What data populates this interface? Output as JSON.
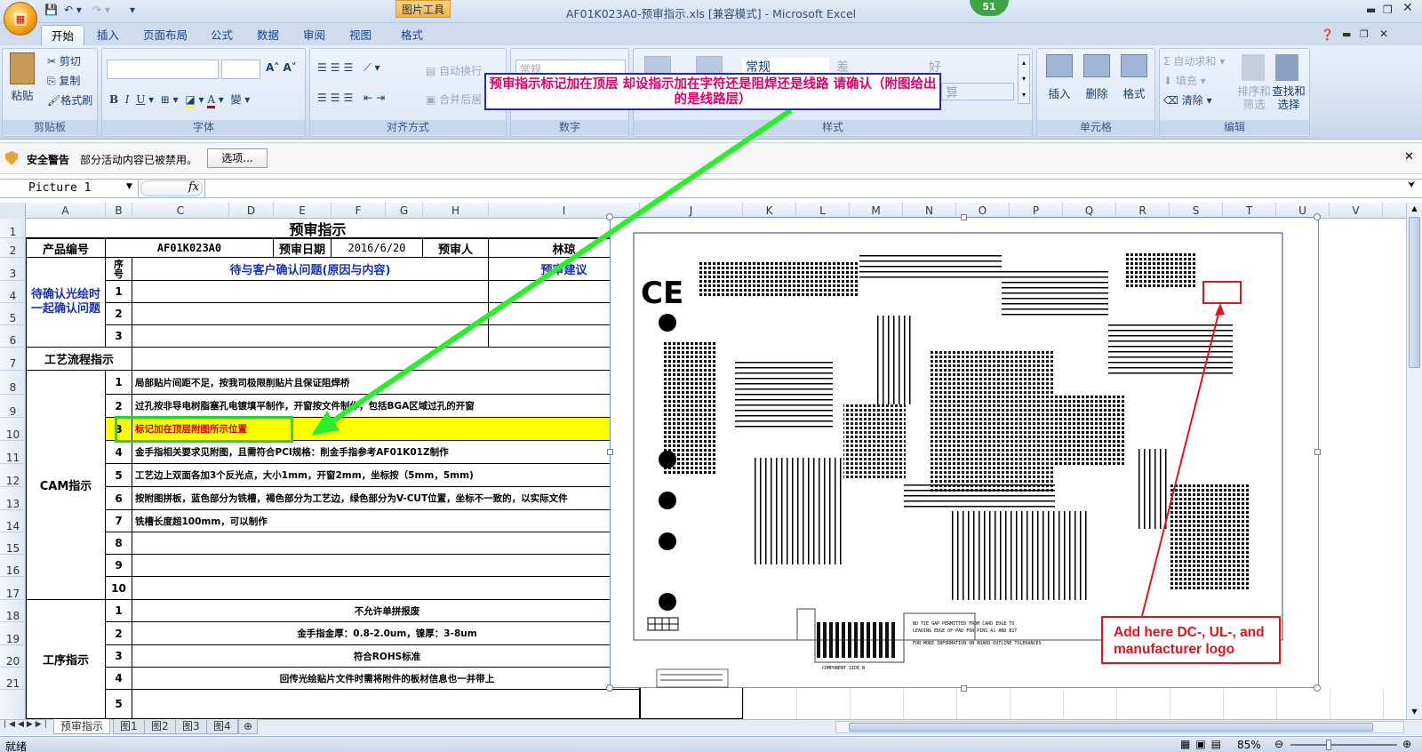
{
  "window": {
    "title": "AF01K023A0-预审指示.xls  [兼容模式] - Microsoft Excel",
    "tools_tab": "图片工具",
    "badge": "51"
  },
  "tabs": [
    "开始",
    "插入",
    "页面布局",
    "公式",
    "数据",
    "审阅",
    "视图",
    "格式"
  ],
  "ribbon": {
    "clipboard": {
      "paste": "粘贴",
      "cut": "剪切",
      "copy": "复制",
      "format_painter": "格式刷",
      "label": "剪贴板"
    },
    "font": {
      "label": "字体"
    },
    "align": {
      "wrap": "自动换行",
      "merge": "合并后居",
      "label": "对齐方式"
    },
    "number": {
      "format": "常规",
      "label": "数字"
    },
    "styles": {
      "normal": "常规",
      "bad": "差",
      "good": "好",
      "calc": "算",
      "label": "样式"
    },
    "cells": {
      "insert": "插入",
      "delete": "删除",
      "format": "格式",
      "label": "单元格"
    },
    "editing": {
      "autosum": "自动求和",
      "fill": "填充",
      "clear": "清除",
      "sort": "排序和",
      "sort2": "筛选",
      "find": "查找和",
      "find2": "选择",
      "label": "编辑"
    }
  },
  "security": {
    "label": "安全警告",
    "message": "部分活动内容已被禁用。",
    "options": "选项..."
  },
  "namebox": "Picture 1",
  "fx": "fx",
  "columns": [
    "A",
    "B",
    "C",
    "D",
    "E",
    "F",
    "G",
    "H",
    "I",
    "J",
    "K",
    "L",
    "M",
    "N",
    "O",
    "P",
    "Q",
    "R",
    "S",
    "T",
    "U",
    "V"
  ],
  "rows": [
    "1",
    "2",
    "3",
    "4",
    "5",
    "6",
    "7",
    "8",
    "9",
    "10",
    "11",
    "12",
    "13",
    "14",
    "15",
    "16",
    "17",
    "18",
    "19",
    "20",
    "21"
  ],
  "sheet": {
    "title": "预审指示",
    "product_no_label": "产品编号",
    "product_no": "AF01K023A0",
    "date_label": "预审日期",
    "date": "2016/6/20",
    "reviewer_label": "预审人",
    "reviewer": "林琼",
    "seq_header": "序号",
    "issue_header": "待与客户确认问题(原因与内容)",
    "advice_header": "预审建议",
    "pending_label": "待确认光绘时一起确认问题",
    "pending_nums": [
      "1",
      "2",
      "3"
    ],
    "process_label": "工艺流程指示",
    "cam_label": "CAM指示",
    "cam_items": [
      {
        "n": "1",
        "t": "局部贴片间距不足，按我司极限削贴片且保证阻焊桥"
      },
      {
        "n": "2",
        "t": "过孔按非导电树脂塞孔电镀填平制作，开窗按文件制作，包括BGA区域过孔的开窗"
      },
      {
        "n": "3",
        "t": "标记加在顶层附图所示位置"
      },
      {
        "n": "4",
        "t": "金手指相关要求见附图，且需符合PCI规格：削金手指参考AF01K01Z制作"
      },
      {
        "n": "5",
        "t": "工艺边上双面各加3个反光点，大小1mm，开窗2mm，坐标按（5mm，5mm)"
      },
      {
        "n": "6",
        "t": "按附图拼板，蓝色部分为铣槽，褐色部分为工艺边，绿色部分为V-CUT位置，坐标不一致的，以实际文件"
      },
      {
        "n": "7",
        "t": "铣槽长度超100mm，可以制作"
      },
      {
        "n": "8",
        "t": ""
      },
      {
        "n": "9",
        "t": ""
      },
      {
        "n": "10",
        "t": ""
      }
    ],
    "process2_label": "工序指示",
    "proc_items": [
      {
        "n": "1",
        "t": "不允许单拼报废"
      },
      {
        "n": "2",
        "t": "金手指金厚：0.8-2.0um，镍厚：3-8um"
      },
      {
        "n": "3",
        "t": "符合ROHS标准"
      },
      {
        "n": "4",
        "t": "回传光绘贴片文件时需将附件的板材信息也一并带上"
      },
      {
        "n": "5",
        "t": ""
      }
    ]
  },
  "annotations": {
    "callout": "预审指示标记加在顶层  却设指示加在字符还是阻焊还是线路  请确认（附图给出的是线路层）",
    "logo_note": "Add here DC-, UL-, and manufacturer logo",
    "ce": "CE",
    "pcb_note1": "NO TIE GAP PERMITTED FROM CARD EDGE TO",
    "pcb_note2": "LEADING EDGE OF PAD FOR PINS A1 AND B1T",
    "pcb_note3": "FOR MORE INFORMATION ON BOARD OUTLINE TOLERANCES",
    "pcb_side": "COMPONENT SIDE B"
  },
  "sheet_tabs": [
    "预审指示",
    "图1",
    "图2",
    "图3",
    "图4"
  ],
  "status": {
    "ready": "就绪",
    "zoom": "85%"
  }
}
